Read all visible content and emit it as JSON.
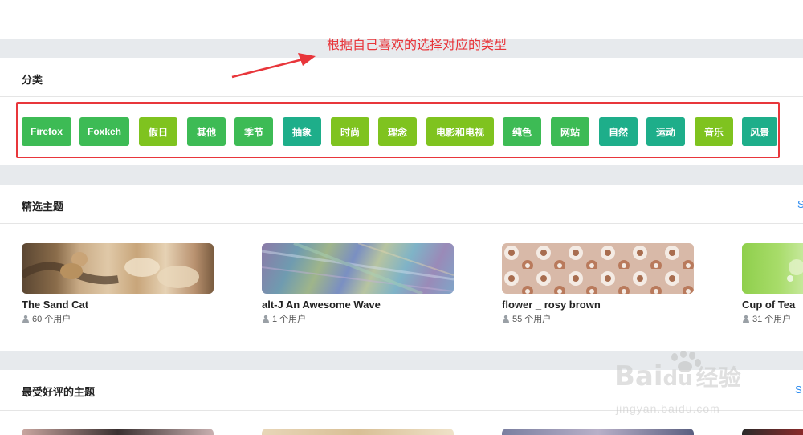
{
  "annotation": {
    "text": "根据自己喜欢的选择对应的类型"
  },
  "categories": {
    "title": "分类",
    "items": [
      {
        "label": "Firefox",
        "color": "#3dbb55"
      },
      {
        "label": "Foxkeh",
        "color": "#3dbb55"
      },
      {
        "label": "假日",
        "color": "#7fc31f"
      },
      {
        "label": "其他",
        "color": "#3dbb55"
      },
      {
        "label": "季节",
        "color": "#3dbb55"
      },
      {
        "label": "抽象",
        "color": "#1eae8a"
      },
      {
        "label": "时尚",
        "color": "#7fc31f"
      },
      {
        "label": "理念",
        "color": "#7fc31f"
      },
      {
        "label": "电影和电视",
        "color": "#7fc31f"
      },
      {
        "label": "纯色",
        "color": "#3dbb55"
      },
      {
        "label": "网站",
        "color": "#3dbb55"
      },
      {
        "label": "自然",
        "color": "#1eae8a"
      },
      {
        "label": "运动",
        "color": "#1eae8a"
      },
      {
        "label": "音乐",
        "color": "#7fc31f"
      },
      {
        "label": "风景",
        "color": "#1eae8a"
      }
    ]
  },
  "featured": {
    "title": "精选主题",
    "see_all": "S",
    "themes": [
      {
        "name": "The Sand Cat",
        "users": "60 个用户"
      },
      {
        "name": "alt-J An Awesome Wave",
        "users": "1 个用户"
      },
      {
        "name": "flower _ rosy brown",
        "users": "55 个用户"
      },
      {
        "name": "Cup of Tea",
        "users": "31 个用户"
      }
    ]
  },
  "top_rated": {
    "title": "最受好评的主题",
    "see_all": "S"
  },
  "watermark": {
    "brand": "Bai",
    "brand2": "经验",
    "url": "jingyan.baidu.com"
  },
  "colors": {
    "accent": "#2d8cf0",
    "highlight": "#e8363b",
    "band": "#e7eaed"
  }
}
